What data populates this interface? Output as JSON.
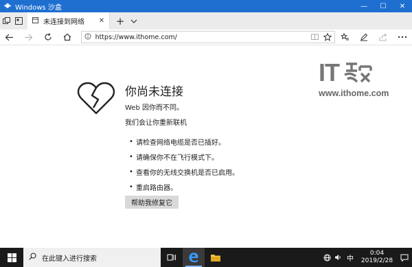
{
  "window": {
    "title": "Windows 沙盒",
    "controls": {
      "minimize": "—",
      "maximize": "☐",
      "close": "✕"
    }
  },
  "tabs": [
    {
      "label": "未连接到网络",
      "active": true
    }
  ],
  "tabbar": {
    "new_tab": "+",
    "tab_menu": "⌄"
  },
  "navbar": {
    "url": "https://www.ithome.com/",
    "back_enabled": true,
    "forward_enabled": false
  },
  "error": {
    "title": "你尚未连接",
    "subtitle": "Web 因你而不同。",
    "hint": "我们会让你重新联机",
    "tips": [
      "请检查网络电缆是否已插好。",
      "请确保你不在飞行模式下。",
      "查看你的无线交换机是否已启用。",
      "重启路由器。"
    ],
    "fix_button": "帮助我修复它"
  },
  "watermark": {
    "logo_text": "IT",
    "site": "www.ithome.com"
  },
  "taskbar": {
    "search_placeholder": "在此键入进行搜索",
    "ime": "中",
    "time": "0:04",
    "date": "2019/2/28"
  },
  "colors": {
    "titlebar": "#1f6fd1",
    "taskbar": "#1a1a1a",
    "button": "#d9d9d9"
  }
}
